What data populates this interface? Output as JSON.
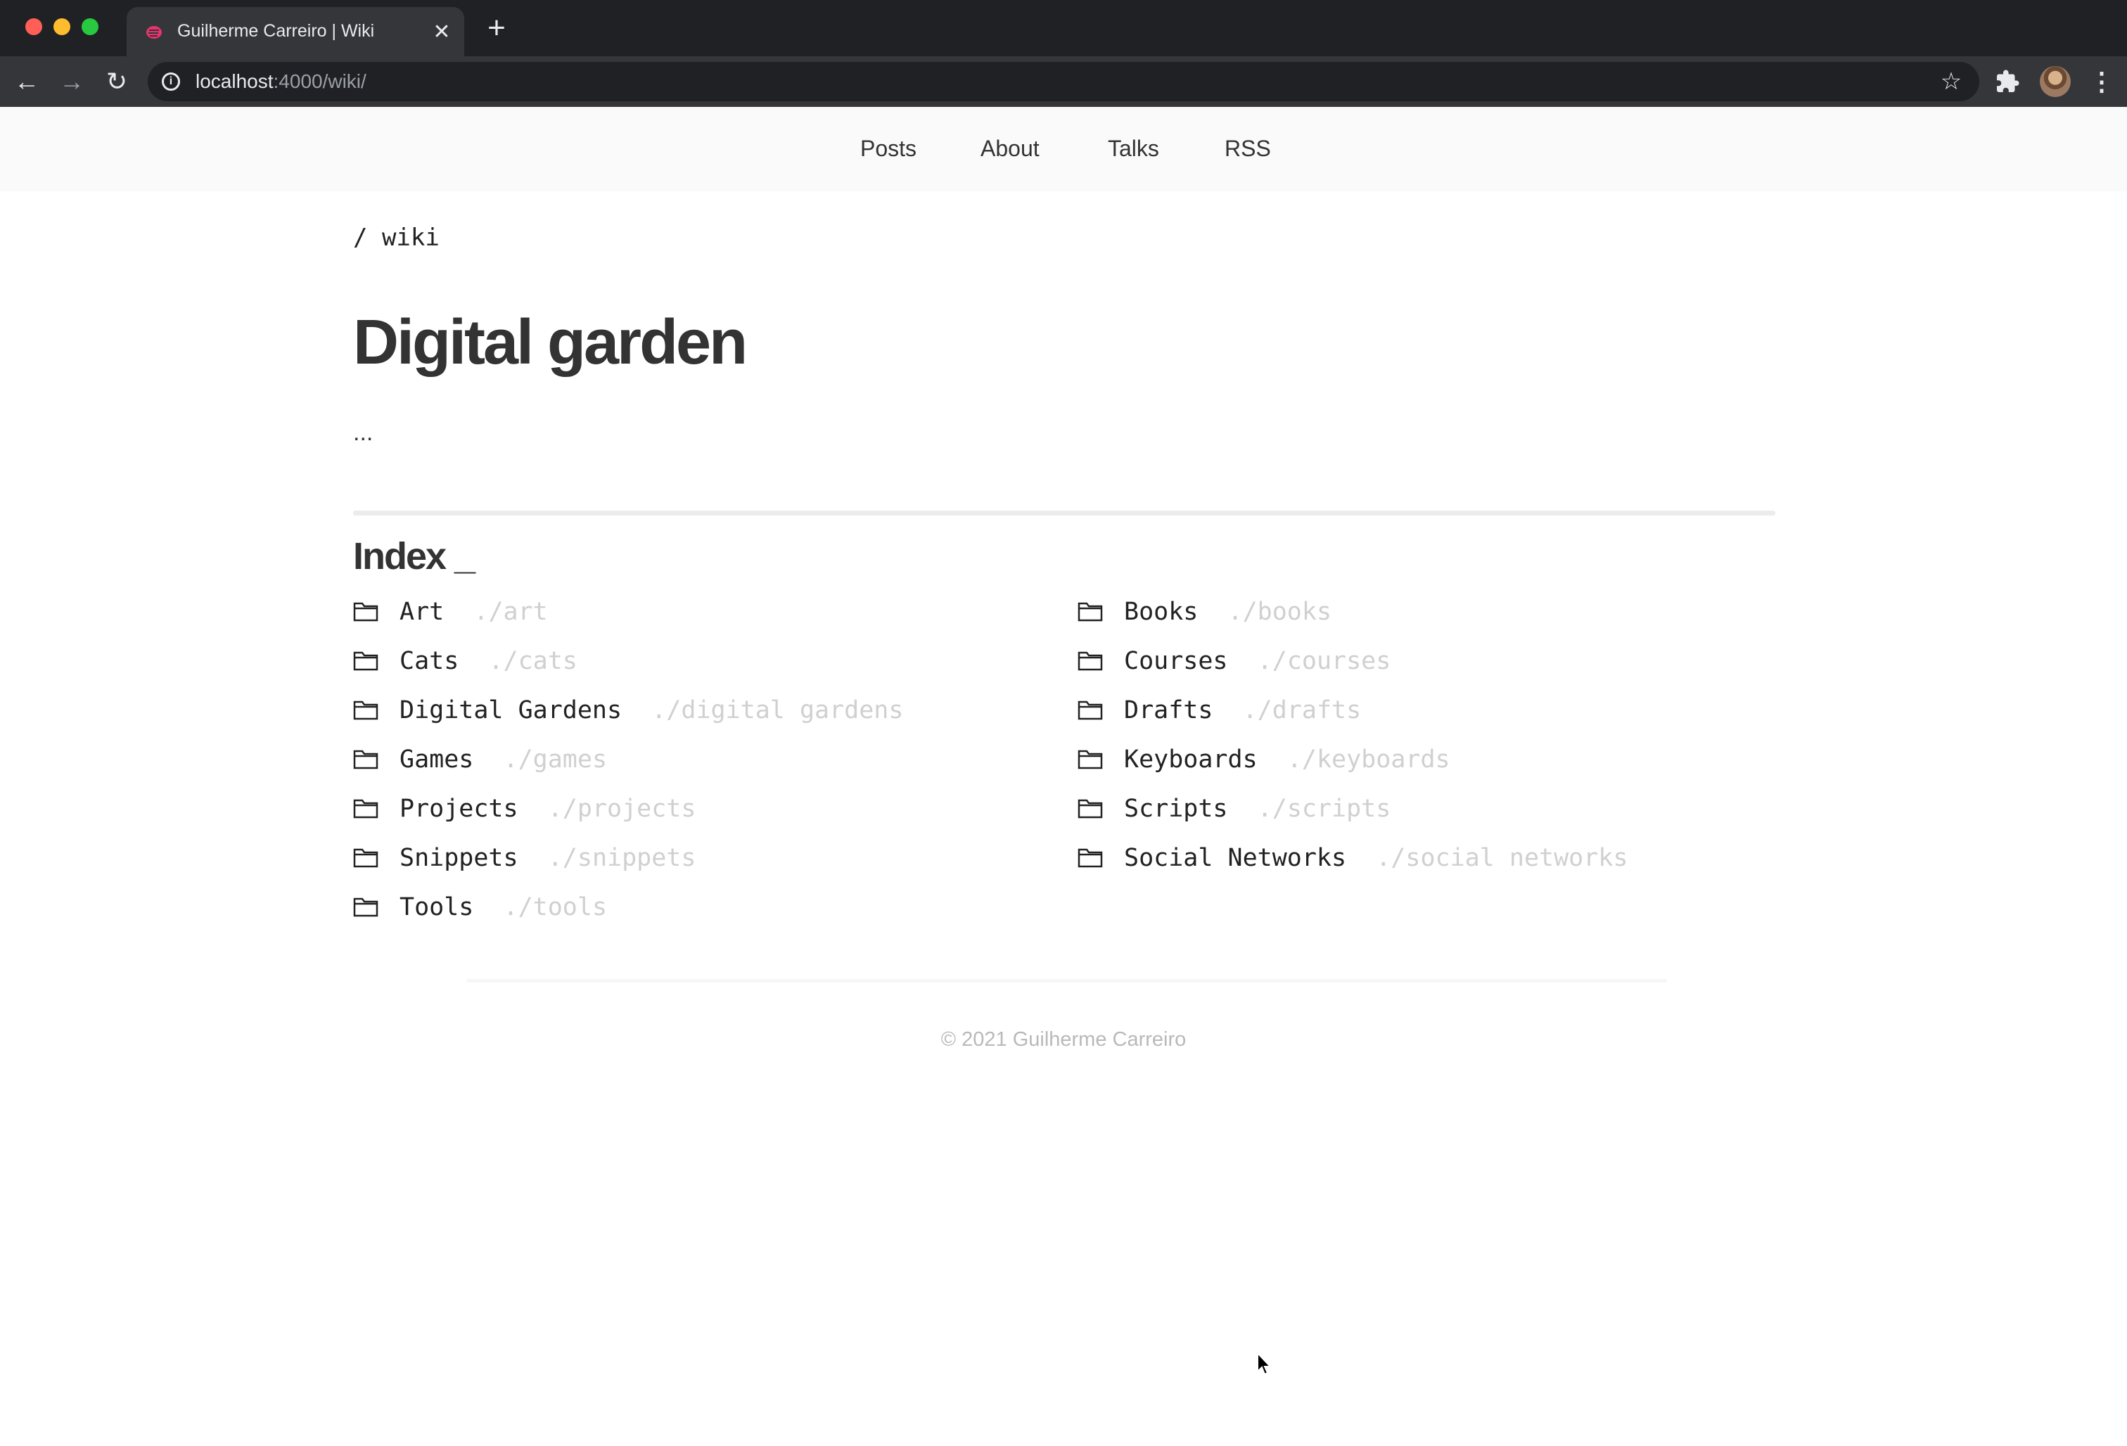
{
  "browser": {
    "tab_title": "Guilherme Carreiro | Wiki",
    "url_host": "localhost",
    "url_rest": ":4000/wiki/"
  },
  "nav": {
    "items": [
      {
        "label": "Posts"
      },
      {
        "label": "About"
      },
      {
        "label": "Talks"
      },
      {
        "label": "RSS"
      }
    ]
  },
  "page": {
    "breadcrumb": "/ wiki",
    "title": "Digital garden",
    "lead": "...",
    "index_title": "Index _"
  },
  "wiki_items": [
    {
      "name": "Art",
      "path": "./art"
    },
    {
      "name": "Books",
      "path": "./books"
    },
    {
      "name": "Cats",
      "path": "./cats"
    },
    {
      "name": "Courses",
      "path": "./courses"
    },
    {
      "name": "Digital Gardens",
      "path": "./digital gardens"
    },
    {
      "name": "Drafts",
      "path": "./drafts"
    },
    {
      "name": "Games",
      "path": "./games"
    },
    {
      "name": "Keyboards",
      "path": "./keyboards"
    },
    {
      "name": "Projects",
      "path": "./projects"
    },
    {
      "name": "Scripts",
      "path": "./scripts"
    },
    {
      "name": "Snippets",
      "path": "./snippets"
    },
    {
      "name": "Social Networks",
      "path": "./social networks"
    },
    {
      "name": "Tools",
      "path": "./tools"
    }
  ],
  "footer": {
    "text": "© 2021 Guilherme Carreiro"
  },
  "colors": {
    "tab_bar": "#202124",
    "toolbar": "#35363a",
    "nav_background": "#fafafa",
    "text": "#333333",
    "path_text": "#d0d0d0",
    "favicon": "#e8336b"
  }
}
